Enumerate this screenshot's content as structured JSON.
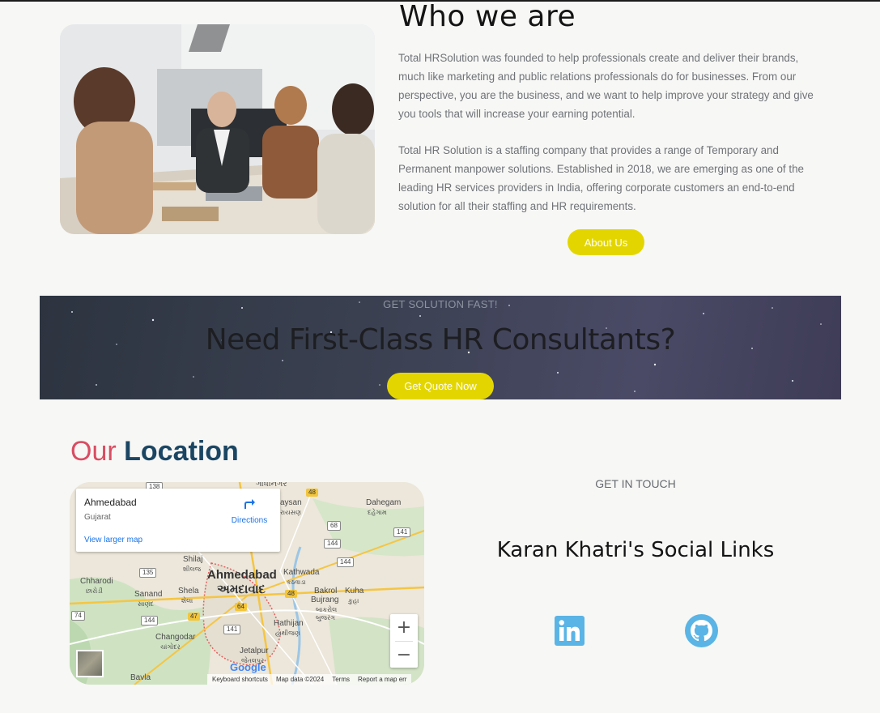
{
  "about": {
    "title": "Who we are",
    "paragraph1": "Total HRSolution was founded to help professionals create and deliver their brands, much like marketing and public relations professionals do for businesses. From our perspective, you are the business, and we want to help improve your strategy and give you tools that will increase your earning potential.",
    "paragraph2": "Total HR Solution is a staffing company that provides a range of Temporary and Permanent manpower solutions. Established in 2018, we are emerging as one of the leading HR services providers in India, offering corporate customers an end-to-end solution for all their staffing and HR requirements.",
    "button_label": "About Us"
  },
  "banner": {
    "eyebrow": "GET SOLUTION FAST!",
    "title": "Need First-Class HR Consultants?",
    "button_label": "Get Quote Now"
  },
  "location": {
    "title_prefix": "Our",
    "title_main": "Location",
    "map": {
      "place_name": "Ahmedabad",
      "region": "Gujarat",
      "directions_label": "Directions",
      "view_larger_label": "View larger map",
      "zoom_in": "+",
      "zoom_out": "−",
      "logo": "Google",
      "footer": [
        "Keyboard shortcuts",
        "Map data ©2024",
        "Terms",
        "Report a map err"
      ],
      "labels": {
        "ahmedabad_en": "Ahmedabad",
        "ahmedabad_gu": "અમદાવાદ",
        "gandhinagar_partial": "ગાંધીનગર",
        "dahegam": "Dahegam",
        "dahegam_gu": "દહેગામ",
        "raysan": "aysan",
        "raysan_gu": "રાયસણ",
        "shilaj": "Shilaj",
        "shilaj_gu": "શીલજ",
        "kathwada": "Kathwada",
        "kathwada_gu": "કઠવાડા",
        "chharodi": "Chharodi",
        "chharodi_gu": "છારોડી",
        "sanand": "Sanand",
        "sanand_gu": "સાણંદ",
        "shela": "Shela",
        "shela_gu": "શેલા",
        "bakrol": "Bakrol",
        "bakrol2": "Bujrang",
        "bakrol_gu": "બાકરોલ",
        "bakrol2_gu": "બુજરંગ",
        "kuha": "Kuha",
        "kuha_gu": "કુહા",
        "changodar": "Changodar",
        "changodar_gu": "ચાંગોદર",
        "hathijan": "Hathijan",
        "hathijan_gu": "હાથીજણ",
        "jetalpur": "Jetalpur",
        "jetalpur_gu": "જેતલપુર",
        "bavla": "Bavla"
      },
      "shields": [
        "138",
        "48",
        "68",
        "141",
        "144",
        "144",
        "135",
        "64",
        "48",
        "47",
        "74",
        "144",
        "141"
      ]
    }
  },
  "social": {
    "eyebrow": "GET IN TOUCH",
    "title": "Karan Khatri's Social Links",
    "linkedin_color": "#5ab4e5",
    "github_color": "#5ab4e5"
  },
  "colors": {
    "accent_yellow": "#e3d600",
    "our_pink": "#d94d62",
    "location_navy": "#1b4663"
  }
}
